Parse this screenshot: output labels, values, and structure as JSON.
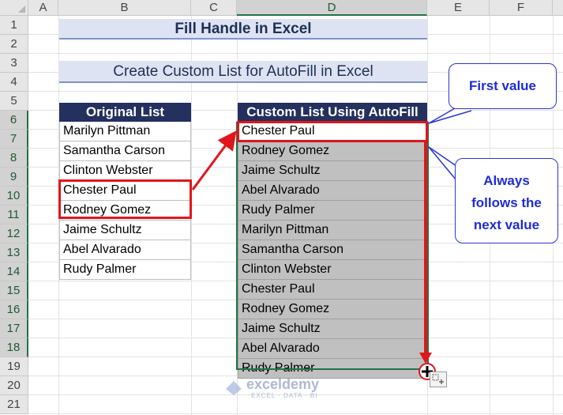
{
  "columns": [
    "A",
    "B",
    "C",
    "D",
    "E",
    "F"
  ],
  "rows": [
    "1",
    "2",
    "3",
    "4",
    "5",
    "6",
    "7",
    "8",
    "9",
    "10",
    "11",
    "12",
    "13",
    "14",
    "15",
    "16",
    "17",
    "18",
    "19",
    "20",
    "21"
  ],
  "title": "Fill Handle in Excel",
  "subtitle": "Create Custom List for AutoFill in Excel",
  "original_list": {
    "header": "Original List",
    "items": [
      "Marilyn Pittman",
      "Samantha Carson",
      "Clinton Webster",
      "Chester Paul",
      "Rodney Gomez",
      "Jaime Schultz",
      "Abel Alvarado",
      "Rudy Palmer"
    ]
  },
  "custom_list": {
    "header": "Custom List Using AutoFill",
    "items": [
      "Chester Paul",
      "Rodney Gomez",
      "Jaime Schultz",
      "Abel Alvarado",
      "Rudy Palmer",
      "Marilyn Pittman",
      "Samantha Carson",
      "Clinton Webster",
      "Chester Paul",
      "Rodney Gomez",
      "Jaime Schultz",
      "Abel Alvarado",
      "Rudy Palmer"
    ]
  },
  "callouts": {
    "first": "First value",
    "always": [
      "Always",
      "follows the",
      "next value"
    ]
  },
  "watermark": {
    "name": "exceldemy",
    "tagline": "EXCEL · DATA · BI"
  },
  "colors": {
    "title_band": "#dde3f3",
    "table_header": "#24305e",
    "fill_grey": "#c0c0c0",
    "highlight_red": "#e0161c",
    "callout_blue": "#2a35d6",
    "selection_green": "#217346"
  },
  "icons": [
    "fill-handle-plus-icon",
    "autofill-options-icon",
    "exceldemy-logo-icon"
  ]
}
